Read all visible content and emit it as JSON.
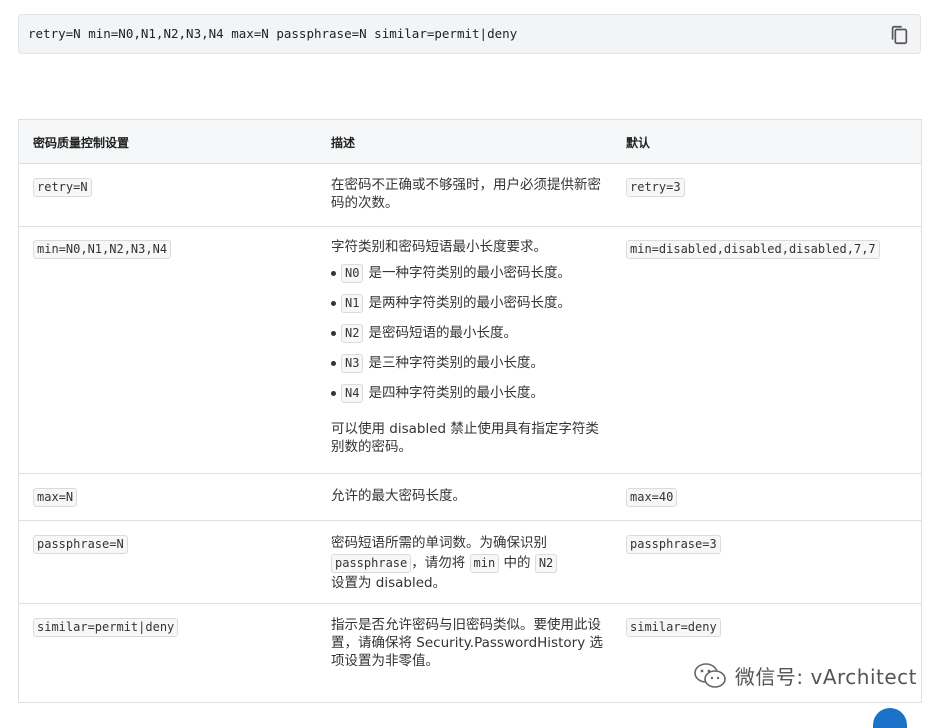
{
  "code_block": {
    "text": "retry=N min=N0,N1,N2,N3,N4 max=N passphrase=N similar=permit|deny",
    "copy_icon": "copy-icon"
  },
  "table": {
    "headers": [
      "密码质量控制设置",
      "描述",
      "默认"
    ],
    "rows": [
      {
        "setting": "retry=N",
        "desc": "在密码不正确或不够强时，用户必须提供新密码的次数。",
        "default": "retry=3"
      },
      {
        "setting": "min=N0,N1,N2,N3,N4",
        "desc_intro": "字符类别和密码短语最小长度要求。",
        "bullets": [
          {
            "token": "N0",
            "text": "是一种字符类别的最小密码长度。"
          },
          {
            "token": "N1",
            "text": "是两种字符类别的最小密码长度。"
          },
          {
            "token": "N2",
            "text": "是密码短语的最小长度。"
          },
          {
            "token": "N3",
            "text": "是三种字符类别的最小长度。"
          },
          {
            "token": "N4",
            "text": "是四种字符类别的最小长度。"
          }
        ],
        "desc_outro": "可以使用 disabled 禁止使用具有指定字符类别数的密码。",
        "default": "min=disabled,disabled,disabled,7,7"
      },
      {
        "setting": "max=N",
        "desc": "允许的最大密码长度。",
        "default": "max=40"
      },
      {
        "setting": "passphrase=N",
        "desc_a": "密码短语所需的单词数。为确保识别",
        "tok_a": "passphrase",
        "desc_b": "，请勿将",
        "tok_b": "min",
        "desc_c": "中的",
        "tok_c": "N2",
        "desc_d": "设置为 disabled。",
        "default": "passphrase=3"
      },
      {
        "setting": "similar=permit|deny",
        "desc": "指示是否允许密码与旧密码类似。要使用此设置，请确保将 Security.PasswordHistory 选项设置为非零值。",
        "default": "similar=deny"
      }
    ]
  },
  "watermark": {
    "text": "微信号: vArchitect",
    "icon": "wechat-icon"
  }
}
